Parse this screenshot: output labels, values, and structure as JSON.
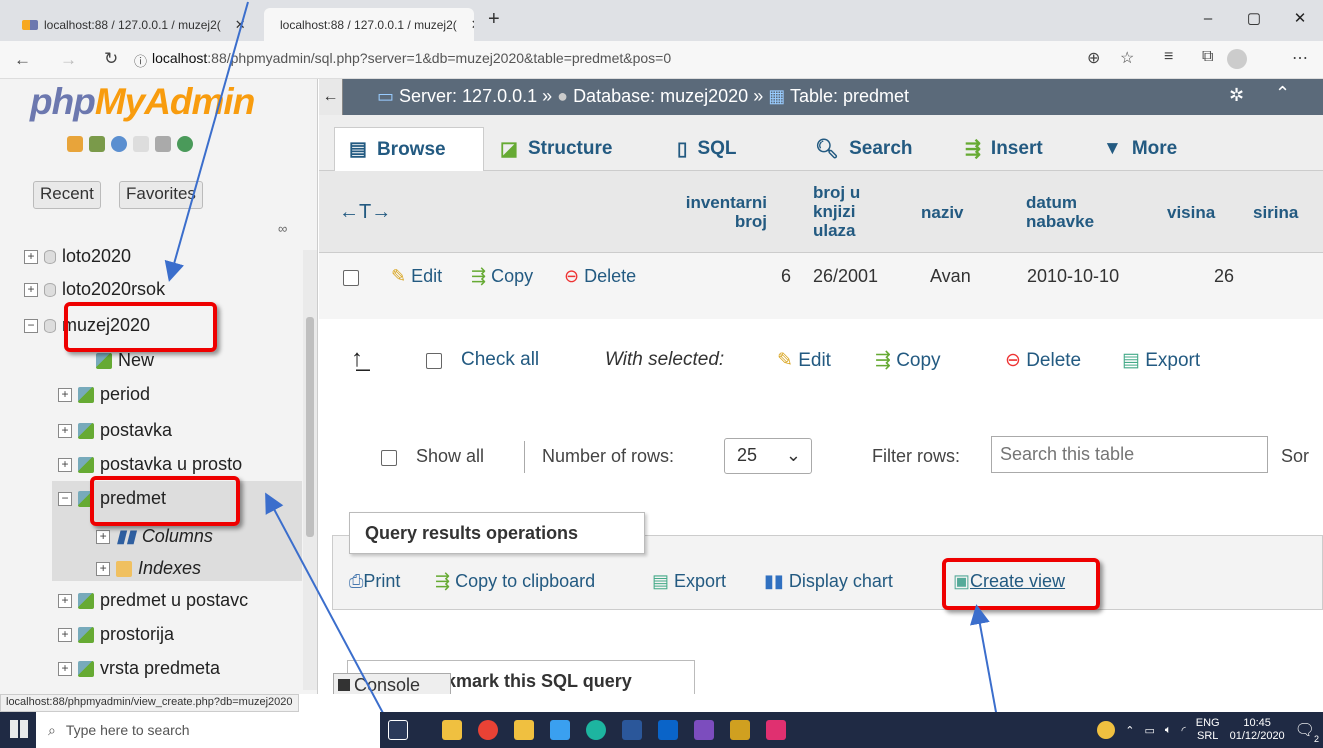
{
  "browser": {
    "tabs": [
      {
        "label": "localhost:88 / 127.0.0.1 / muzej2("
      },
      {
        "label": "localhost:88 / 127.0.0.1 / muzej2("
      }
    ],
    "new_tab": "+",
    "url_host": "localhost",
    "url_rest": ":88/phpmyadmin/sql.php?server=1&db=muzej2020&table=predmet&pos=0",
    "status_url": "localhost:88/phpmyadmin/view_create.php?db=muzej2020"
  },
  "sidebar": {
    "logo_a": "php",
    "logo_b": "MyAdmin",
    "recent": "Recent",
    "favorites": "Favorites",
    "items": [
      {
        "label": "loto2020"
      },
      {
        "label": "loto2020rsok"
      },
      {
        "label": "muzej2020"
      },
      {
        "label": "New"
      },
      {
        "label": "period"
      },
      {
        "label": "postavka"
      },
      {
        "label": "postavka u prosto"
      },
      {
        "label": "predmet"
      },
      {
        "label": "Columns"
      },
      {
        "label": "Indexes"
      },
      {
        "label": "predmet u postavc"
      },
      {
        "label": "prostorija"
      },
      {
        "label": "vrsta predmeta"
      }
    ]
  },
  "breadcrumb": {
    "server": "Server: 127.0.0.1",
    "database": "Database: muzej2020",
    "table": "Table: predmet",
    "sep": "»"
  },
  "tabs": [
    {
      "label": "Browse"
    },
    {
      "label": "Structure"
    },
    {
      "label": "SQL"
    },
    {
      "label": "Search"
    },
    {
      "label": "Insert"
    },
    {
      "label": "More"
    }
  ],
  "table": {
    "arrows": "←T→",
    "headers": [
      [
        "inventarni",
        "broj"
      ],
      [
        "broj u",
        "knjizi",
        "ulaza"
      ],
      [
        "naziv"
      ],
      [
        "datum",
        "nabavke"
      ],
      [
        "visina"
      ],
      [
        "sirina"
      ]
    ],
    "row": {
      "edit": "Edit",
      "copy": "Copy",
      "delete": "Delete",
      "cells": [
        "6",
        "26/2001",
        "Avan",
        "2010-10-10",
        "26"
      ]
    }
  },
  "bulk": {
    "check_all": "Check all",
    "with_selected": "With selected:",
    "edit": "Edit",
    "copy": "Copy",
    "delete": "Delete",
    "export": "Export"
  },
  "rows_ctrl": {
    "show_all": "Show all",
    "number_of_rows": "Number of rows:",
    "rows_value": "25",
    "filter": "Filter rows:",
    "filter_placeholder": "Search this table",
    "sort": "Sor"
  },
  "query_ops": {
    "title": "Query results operations",
    "print": "Print",
    "copy_clip": "Copy to clipboard",
    "export": "Export",
    "display_chart": "Display chart",
    "create_view": "Create view"
  },
  "bookmark": {
    "title": "kmark this SQL query",
    "console": "Console"
  },
  "taskbar": {
    "search": "Type here to search",
    "lang": "ENG",
    "region": "SRL",
    "time": "10:45",
    "date": "01/12/2020",
    "badge": "2"
  }
}
